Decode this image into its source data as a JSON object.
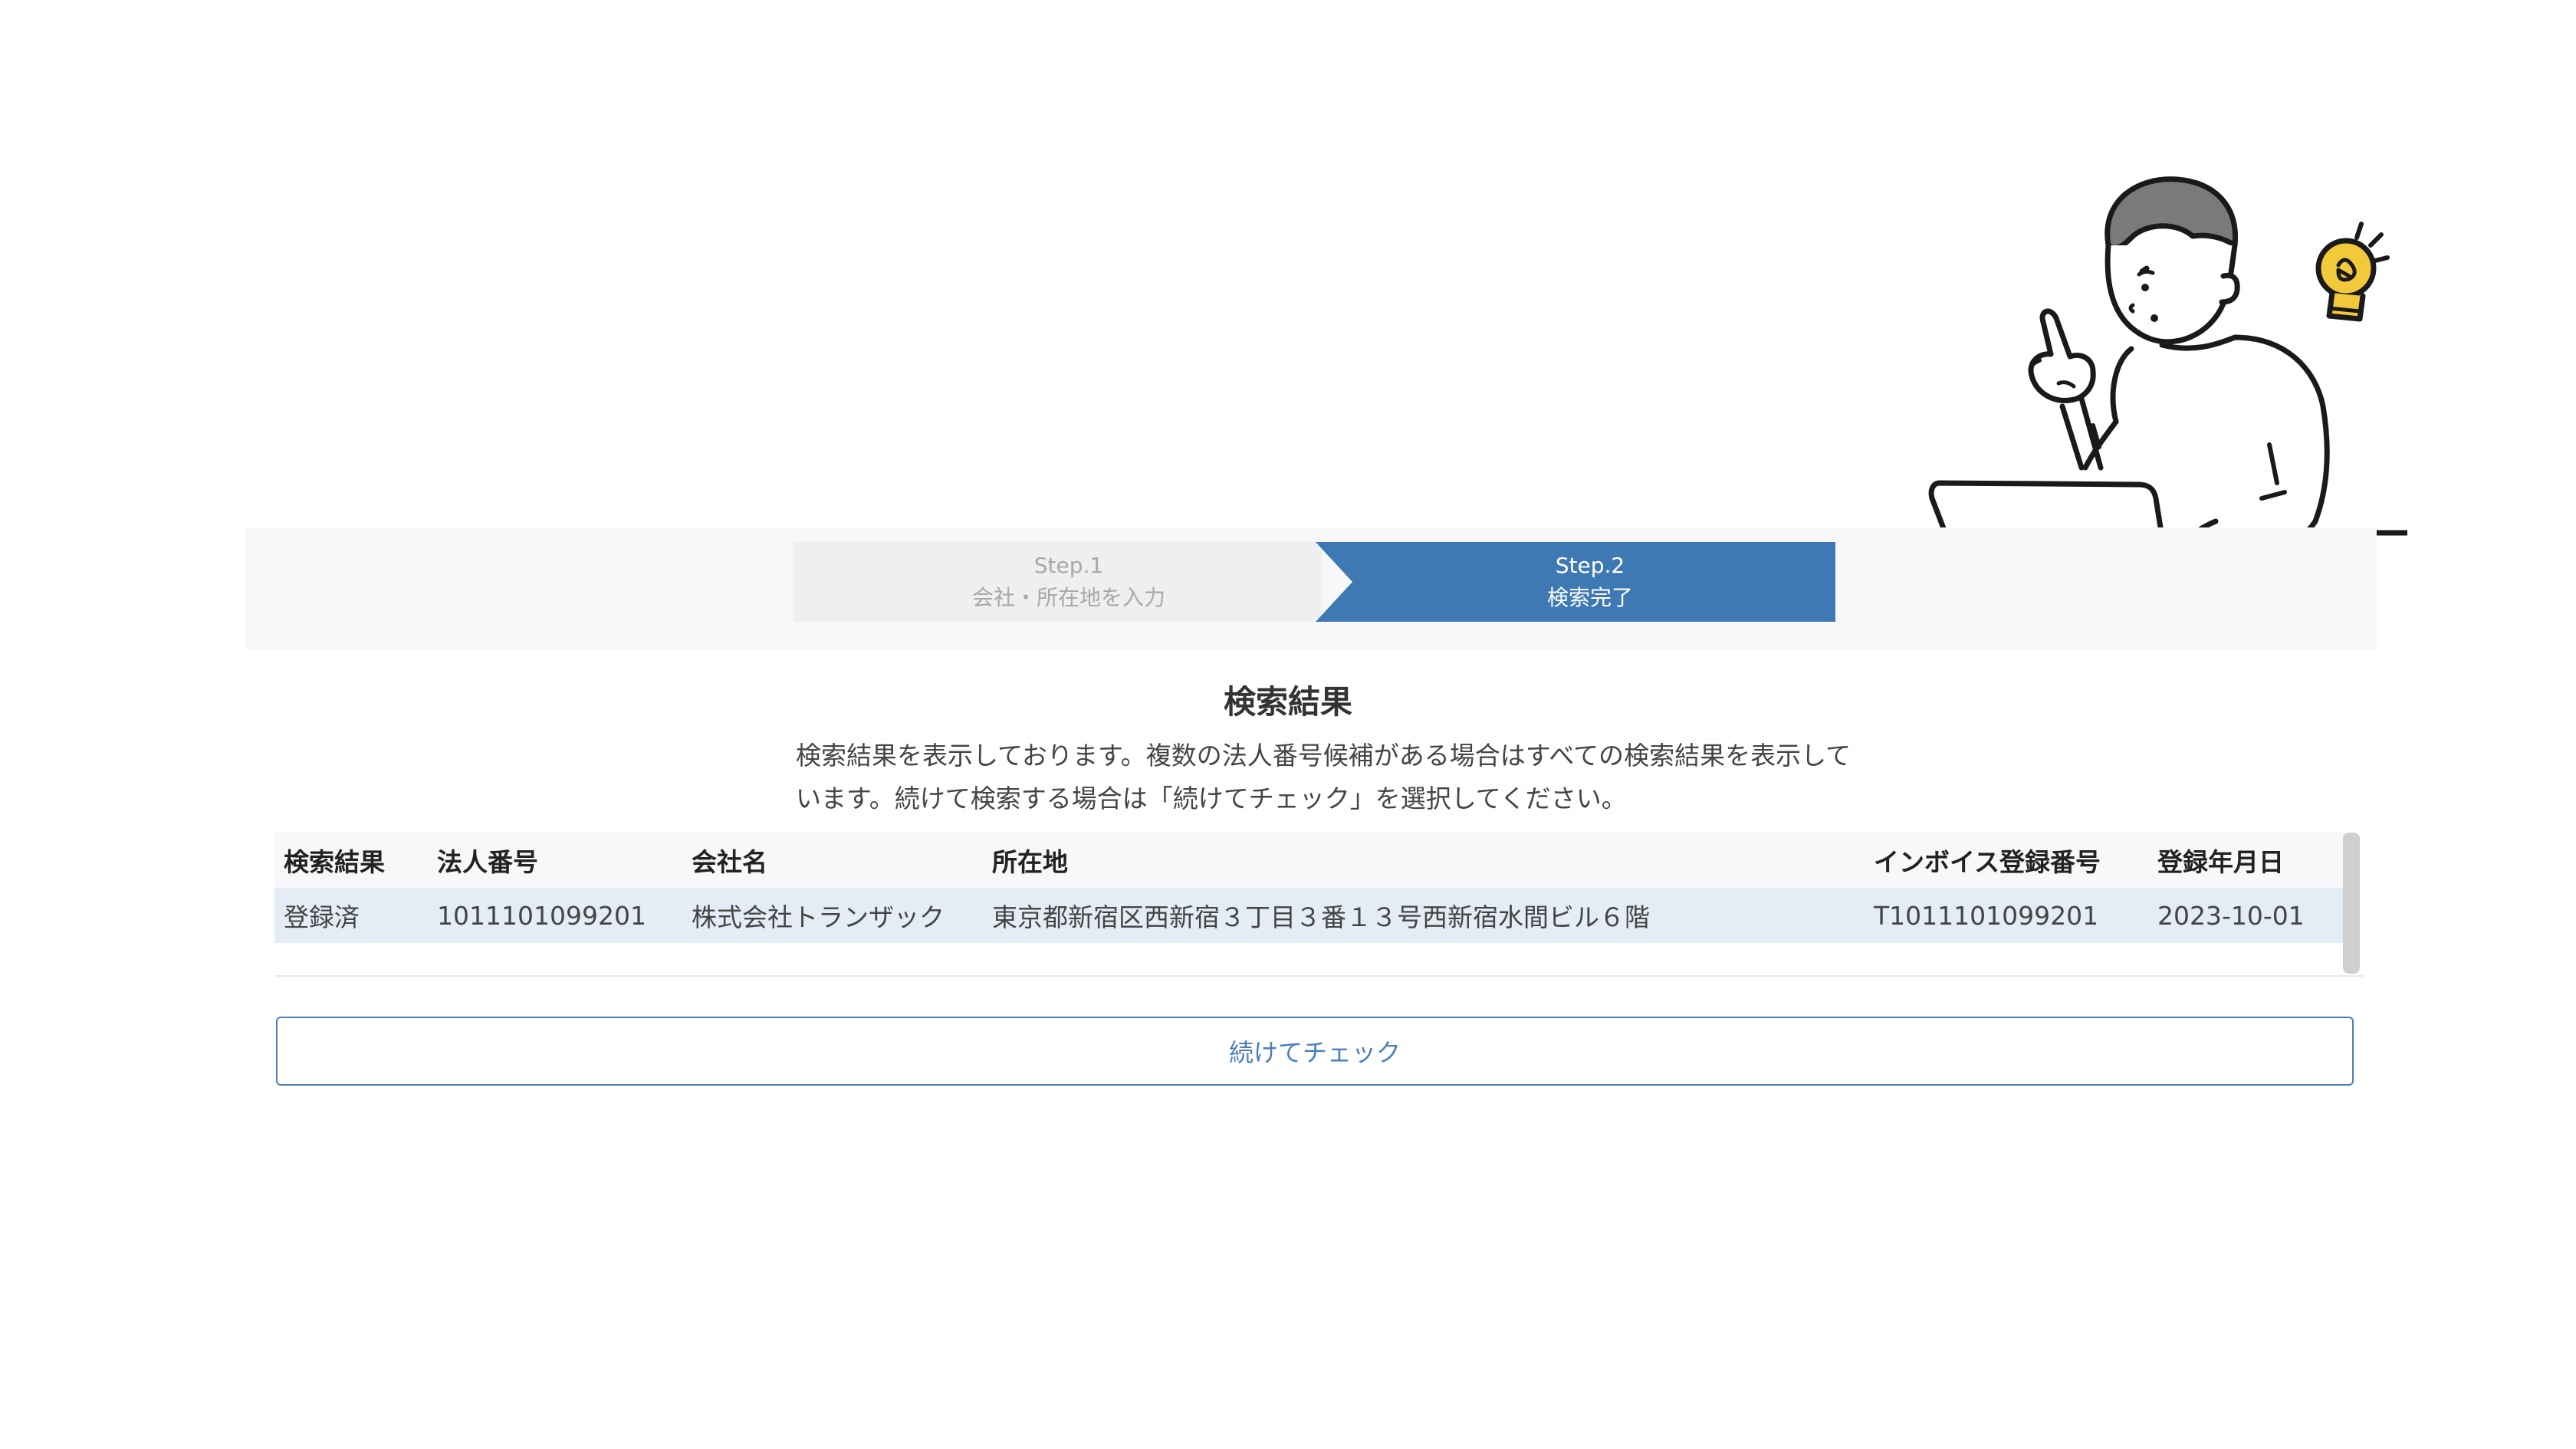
{
  "steps": [
    {
      "label": "Step.1",
      "text": "会社・所在地を入力",
      "active": false
    },
    {
      "label": "Step.2",
      "text": "検索完了",
      "active": true
    }
  ],
  "result": {
    "title": "検索結果",
    "description": "検索結果を表示しております。複数の法人番号候補がある場合はすべての検索結果を表示しています。続けて検索する場合は「続けてチェック」を選択してください。"
  },
  "table": {
    "headers": [
      "検索結果",
      "法人番号",
      "会社名",
      "所在地",
      "インボイス登録番号",
      "登録年月日"
    ],
    "rows": [
      [
        "登録済",
        "1011101099201",
        "株式会社トランザック",
        "東京都新宿区西新宿３丁目３番１３号西新宿水間ビル６階",
        "T1011101099201",
        "2023-10-01"
      ]
    ]
  },
  "buttons": {
    "continue_label": "続けてチェック"
  },
  "colors": {
    "accent": "#3f79b3",
    "inactive_step": "#efefef",
    "row_highlight": "#e4edf5",
    "bulb": "#f3c93c"
  },
  "illustration": {
    "icon": "person-with-laptop-and-lightbulb"
  }
}
